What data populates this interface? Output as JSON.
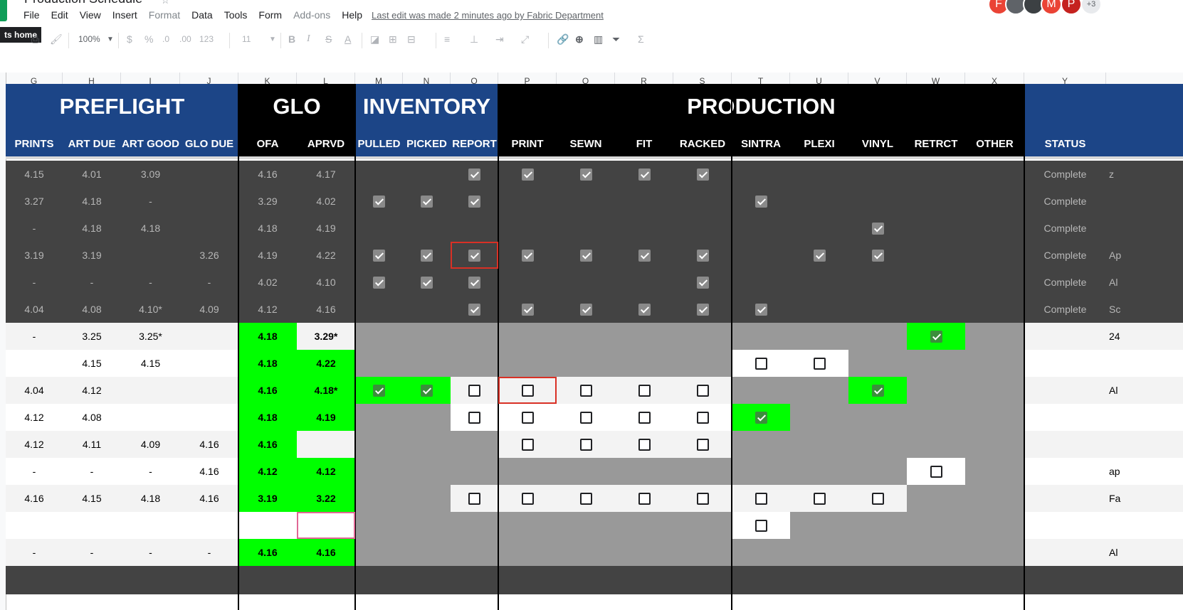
{
  "app": {
    "title": "Production Schedule",
    "menus": [
      "File",
      "Edit",
      "View",
      "Insert",
      "Format",
      "Data",
      "Tools",
      "Form",
      "Add-ons",
      "Help"
    ],
    "dim_menus": [
      "Format",
      "Add-ons"
    ],
    "last_edit": "Last edit was made 2 minutes ago by Fabric Department",
    "avatars": [
      {
        "letter": "F",
        "color": "#ea4335"
      },
      {
        "letter": "",
        "color": "#5f6368"
      },
      {
        "letter": "",
        "color": "#3c4043"
      },
      {
        "letter": "M",
        "color": "#ea4335"
      },
      {
        "letter": "P",
        "color": "#c5221f"
      }
    ],
    "more_users": "+3"
  },
  "toolbar": {
    "tooltip": "ts home",
    "zoom": "100%",
    "currency": "$",
    "percent": "%",
    "dec_less": ".0",
    "dec_more": ".00",
    "format_more": "123",
    "font_size": "11",
    "bold": "B",
    "italic": "I",
    "strike": "S",
    "text_color": "A",
    "sum": "Σ"
  },
  "columns": [
    "G",
    "H",
    "I",
    "J",
    "K",
    "L",
    "M",
    "N",
    "O",
    "P",
    "Q",
    "R",
    "S",
    "T",
    "U",
    "V",
    "W",
    "X",
    "Y"
  ],
  "groups": [
    {
      "name": "PREFLIGHT"
    },
    {
      "name": "GLO"
    },
    {
      "name": "INVENTORY"
    },
    {
      "name": "PRODUCTION"
    }
  ],
  "subheaders": [
    "PRINTS",
    "ART DUE",
    "ART GOOD",
    "GLO DUE",
    "OFA",
    "APRVD",
    "PULLED",
    "PICKED",
    "REPORT",
    "PRINT",
    "SEWN",
    "FIT",
    "RACKED",
    "SINTRA",
    "PLEXI",
    "VINYL",
    "RETRCT",
    "OTHER",
    "STATUS"
  ],
  "status_value": "Complete",
  "colors": {
    "blue_header": "#1c4587",
    "black_header": "#000000",
    "dark_row": "#434343",
    "grey_cell": "#999999",
    "green": "#00ff00",
    "light_row": "#f3f3f3"
  },
  "rows": [
    {
      "style": "dark",
      "text": [
        "4.15",
        "4.01",
        "3.09",
        "",
        "4.16",
        "4.17"
      ],
      "checks": {
        "O": "on",
        "P": "on",
        "Q": "on",
        "R": "on",
        "S": "on"
      },
      "status": "Complete",
      "note": "z"
    },
    {
      "style": "dark",
      "text": [
        "3.27",
        "4.18",
        "-",
        "",
        "3.29",
        "4.02"
      ],
      "checks": {
        "M": "on",
        "N": "on",
        "O": "on",
        "T": "on"
      },
      "status": "Complete",
      "note": ""
    },
    {
      "style": "dark",
      "text": [
        "-",
        "4.18",
        "4.18",
        "",
        "4.18",
        "4.19"
      ],
      "checks": {
        "V": "on"
      },
      "status": "Complete",
      "note": ""
    },
    {
      "style": "dark",
      "text": [
        "3.19",
        "3.19",
        "",
        "3.26",
        "4.19",
        "4.22"
      ],
      "checks": {
        "M": "on",
        "N": "on",
        "O": "on",
        "P": "on",
        "Q": "on",
        "R": "on",
        "S": "on",
        "U": "on",
        "V": "on"
      },
      "status": "Complete",
      "note": "Ap"
    },
    {
      "style": "dark",
      "text": [
        "-",
        "-",
        "-",
        "-",
        "4.02",
        "4.10"
      ],
      "checks": {
        "M": "on",
        "N": "on",
        "O": "on",
        "S": "on"
      },
      "status": "Complete",
      "note": "Al"
    },
    {
      "style": "dark",
      "text": [
        "4.04",
        "4.08",
        "4.10*",
        "4.09",
        "4.12",
        "4.16"
      ],
      "checks": {
        "O": "on",
        "P": "on",
        "Q": "on",
        "R": "on",
        "S": "on",
        "T": "on"
      },
      "status": "Complete",
      "note": "Sc"
    },
    {
      "style": "light",
      "text": [
        "-",
        "3.25",
        "3.25*",
        "",
        "4.18",
        "3.29*"
      ],
      "checks": {
        "W": "on"
      },
      "status": "",
      "note": "24"
    },
    {
      "style": "white",
      "text": [
        "",
        "4.15",
        "4.15",
        "",
        "4.18",
        "4.22"
      ],
      "checks": {
        "T": "off",
        "U": "off"
      },
      "status": "",
      "note": ""
    },
    {
      "style": "light",
      "text": [
        "4.04",
        "4.12",
        "",
        "",
        "4.16",
        "4.18*"
      ],
      "checks": {
        "M": "on",
        "N": "on",
        "O": "off",
        "P": "off",
        "Q": "off",
        "R": "off",
        "S": "off",
        "V": "on"
      },
      "status": "",
      "note": "Al"
    },
    {
      "style": "white",
      "text": [
        "4.12",
        "4.08",
        "",
        "",
        "4.18",
        "4.19"
      ],
      "checks": {
        "O": "off",
        "P": "off",
        "Q": "off",
        "R": "off",
        "S": "off",
        "T": "on"
      },
      "status": "",
      "note": ""
    },
    {
      "style": "light",
      "text": [
        "4.12",
        "4.11",
        "4.09",
        "4.16",
        "4.16",
        ""
      ],
      "checks": {
        "P": "off",
        "Q": "off",
        "R": "off",
        "S": "off"
      },
      "status": "",
      "note": ""
    },
    {
      "style": "white",
      "text": [
        "-",
        "-",
        "-",
        "4.16",
        "4.12",
        "4.12"
      ],
      "checks": {
        "W": "off"
      },
      "status": "",
      "note": "ap"
    },
    {
      "style": "light",
      "text": [
        "4.16",
        "4.15",
        "4.18",
        "4.16",
        "3.19",
        "3.22"
      ],
      "checks": {
        "O": "off",
        "P": "off",
        "Q": "off",
        "R": "off",
        "S": "off",
        "T": "off",
        "U": "off",
        "V": "off"
      },
      "status": "",
      "note": "Fa"
    },
    {
      "style": "white",
      "text": [
        "",
        "",
        "",
        "",
        "",
        ""
      ],
      "checks": {
        "T": "off"
      },
      "status": "",
      "note": ""
    },
    {
      "style": "light",
      "text": [
        "-",
        "-",
        "-",
        "-",
        "4.16",
        "4.16"
      ],
      "checks": {},
      "status": "",
      "note": "Al"
    }
  ]
}
